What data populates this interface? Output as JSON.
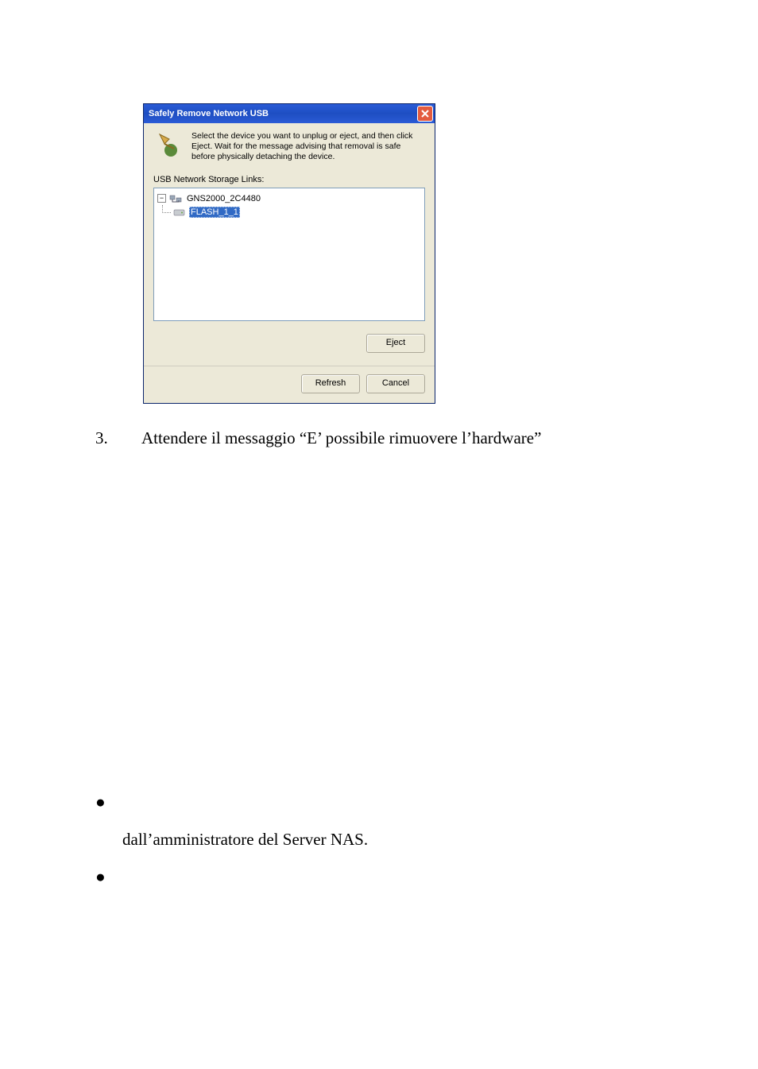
{
  "dialog": {
    "title": "Safely Remove Network USB",
    "description": "Select the device you want to unplug or eject, and then click Eject. Wait for the message advising that removal is safe before physically detaching the device.",
    "links_label": "USB Network Storage Links:",
    "tree": {
      "parent": "GNS2000_2C4480",
      "child": "FLASH_1_1"
    },
    "buttons": {
      "eject": "Eject",
      "refresh": "Refresh",
      "cancel": "Cancel"
    },
    "expander": "−"
  },
  "body": {
    "list_number": "3.",
    "step_text": "Attendere il messaggio “E’ possibile rimuovere l’hardware”",
    "bullet_text": "dall’amministratore del Server NAS."
  }
}
